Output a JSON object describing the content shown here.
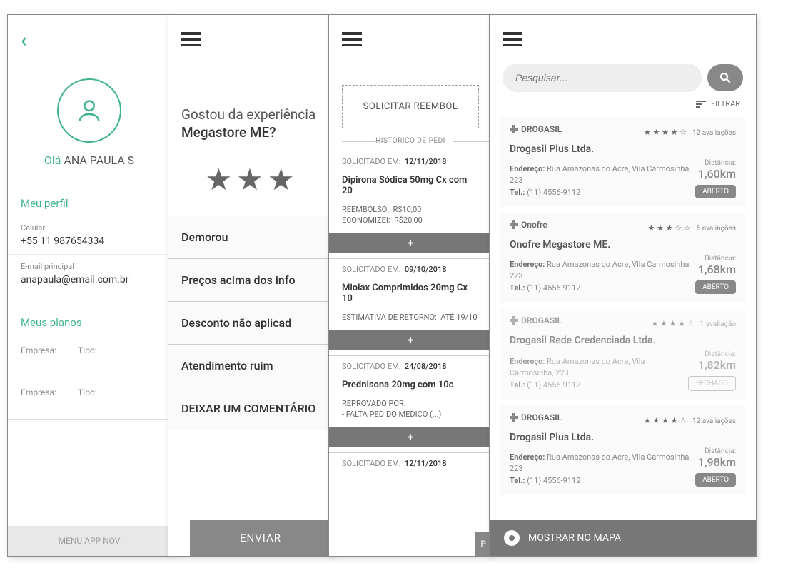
{
  "screen1": {
    "greeting_hello": "Olá",
    "greeting_name": "ANA PAULA S",
    "section_profile": "Meu perfil",
    "cel_label": "Celular",
    "cel_value": "+55 11 987654334",
    "email_label": "E-mail principal",
    "email_value": "anapaula@email.com.br",
    "section_plans": "Meus planos",
    "plan_company": "Empresa:",
    "plan_type": "Tipo:",
    "footer": "MENU APP NOV"
  },
  "screen2": {
    "question": "Gostou da experiência",
    "subject": "Megastore ME?",
    "options": [
      "Demorou",
      "Preços acima dos info",
      "Desconto não aplicad",
      "Atendimento ruim",
      "DEIXAR UM COMENTÁRIO"
    ],
    "submit": "ENVIAR"
  },
  "screen3": {
    "request_btn": "SOLICITAR REEMBOL",
    "history_label": "HISTÓRICO DE PEDI",
    "items": [
      {
        "req_lbl": "SOLICITADO EM:",
        "req_date": "12/11/2018",
        "product": "Dipirona Sódica 50mg Cx com 20",
        "reimb_lbl": "REEMBOLSO:",
        "reimb_val": "R$10,00",
        "save_lbl": "ECONOMIZEI:",
        "save_val": "R$20,00"
      },
      {
        "req_lbl": "SOLICITADO EM:",
        "req_date": "09/10/2018",
        "product": "Miolax Comprimidos 20mg Cx 10",
        "est_lbl": "ESTIMATIVA DE RETORNO:",
        "est_val": "ATÉ 19/10"
      },
      {
        "req_lbl": "SOLICITADO EM:",
        "req_date": "24/08/2018",
        "product": "Prednisona 20mg com 10c",
        "rej_lbl": "REPROVADO POR:",
        "rej_val": "- FALTA PEDIDO MÉDICO (...)"
      },
      {
        "req_lbl": "SOLICITADO EM:",
        "req_date": "12/11/2018"
      }
    ],
    "pay_btn": "P"
  },
  "screen4": {
    "search_placeholder": "Pesquisar...",
    "filter": "FILTRAR",
    "map_btn": "MOSTRAR NO MAPA",
    "cards": [
      {
        "brand": "DROGASIL",
        "stars": "★ ★ ★ ★ ☆",
        "rating_count": "12 avaliações",
        "name": "Drogasil Plus Ltda.",
        "addr_lbl": "Endereço:",
        "addr": "Rua Amazonas do Acre, Vila Carmosinha,  223",
        "tel_lbl": "Tel.:",
        "tel": "(11) 4556-9112",
        "dist_lbl": "Distância:",
        "dist": "1,60km",
        "status": "ABERTO",
        "open": true
      },
      {
        "brand": "Onofre",
        "stars": "★ ★ ★ ☆ ☆",
        "rating_count": "6 avaliações",
        "name": "Onofre Megastore ME.",
        "addr_lbl": "Endereço:",
        "addr": "Rua Amazonas do Acre, Vila Carmosinha,  223",
        "tel_lbl": "Tel.:",
        "tel": "(11) 4556-9112",
        "dist_lbl": "Distância:",
        "dist": "1,68km",
        "status": "ABERTO",
        "open": true
      },
      {
        "brand": "DROGASIL",
        "stars": "★ ★ ★ ★ ☆",
        "rating_count": "1 avaliação",
        "name": "Drogasil Rede Credenciada Ltda.",
        "addr_lbl": "Endereço:",
        "addr": "Rua Amazonas do Acre, Vila Carmosinha,  223",
        "tel_lbl": "Tel.:",
        "tel": "(11) 4556-9112",
        "dist_lbl": "Distância:",
        "dist": "1,82km",
        "status": "FECHADO",
        "open": false
      },
      {
        "brand": "DROGASIL",
        "stars": "★ ★ ★ ★ ☆",
        "rating_count": "12 avaliações",
        "name": "Drogasil Plus Ltda.",
        "addr_lbl": "Endereço:",
        "addr": "Rua Amazonas do Acre, Vila Carmosinha,  223",
        "tel_lbl": "Tel.:",
        "tel": "(11) 4556-9112",
        "dist_lbl": "Distância:",
        "dist": "1,98km",
        "status": "ABERTO",
        "open": true
      }
    ]
  }
}
